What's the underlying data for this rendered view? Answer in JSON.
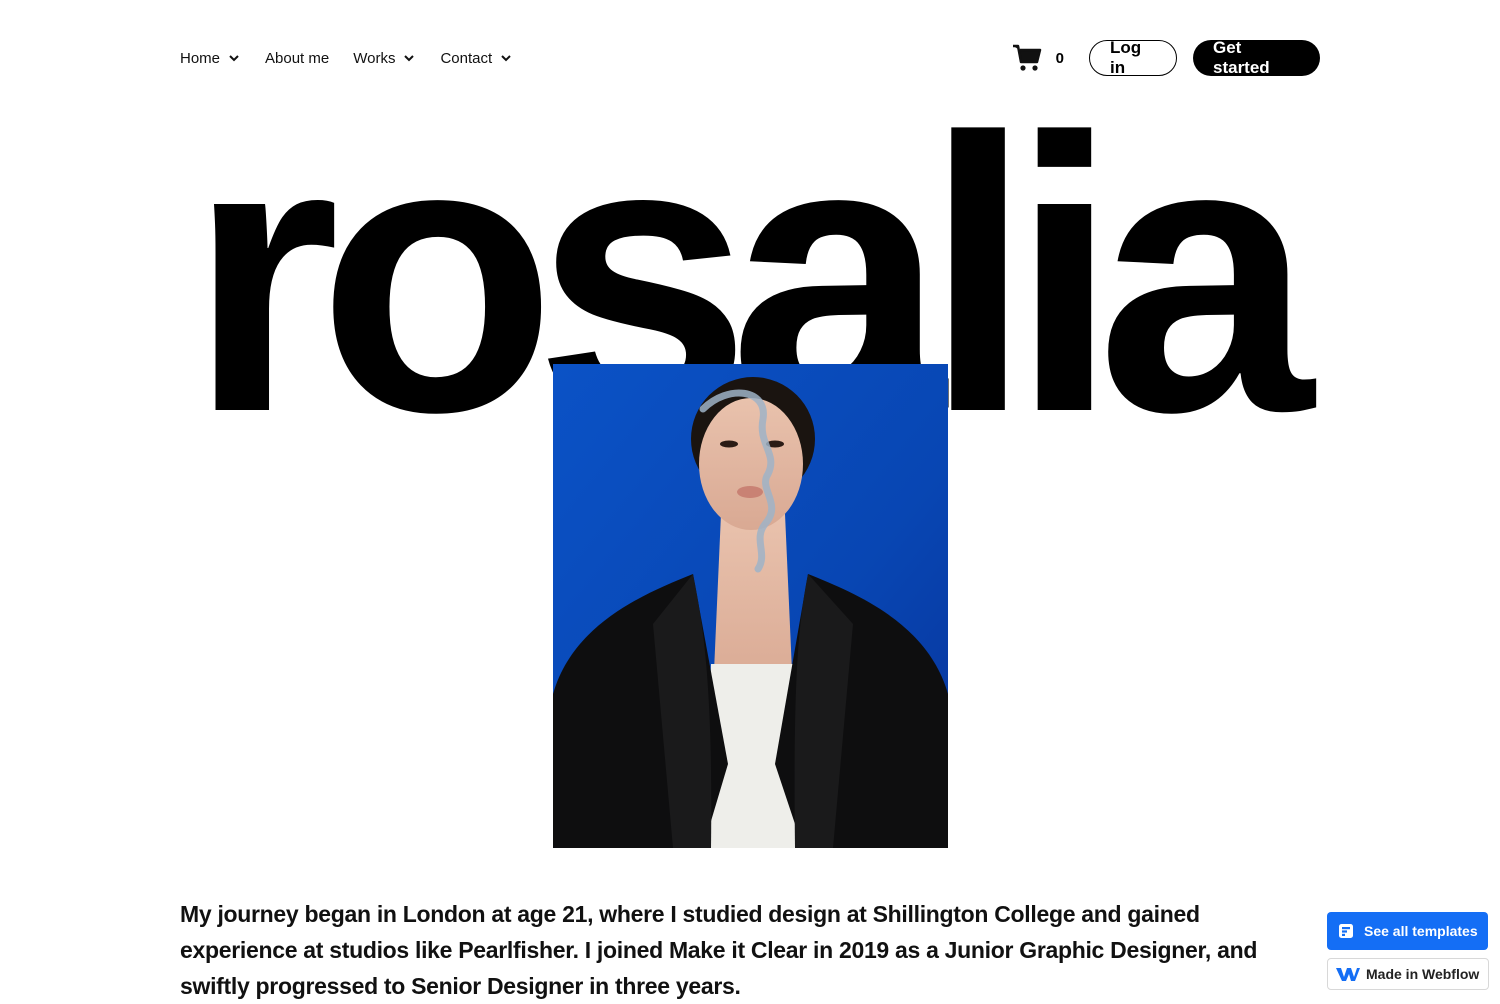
{
  "nav": {
    "items": [
      {
        "label": "Home",
        "has_dropdown": true
      },
      {
        "label": "About me",
        "has_dropdown": false
      },
      {
        "label": "Works",
        "has_dropdown": true
      },
      {
        "label": "Contact",
        "has_dropdown": true
      }
    ],
    "cart_count": "0",
    "login_label": "Log in",
    "cta_label": "Get started"
  },
  "hero": {
    "title": "rosalia",
    "portrait_icon": "portrait-photo"
  },
  "intro": {
    "text": "My journey began in London at age 21, where I studied design at Shillington College and gained experience at studios like Pearlfisher. I joined Make it Clear in 2019 as a Junior Graphic Designer, and swiftly progressed to Senior Designer in three years."
  },
  "badges": {
    "templates_label": "See all templates",
    "made_in_label": "Made in Webflow"
  },
  "colors": {
    "accent_blue": "#146ef5",
    "portrait_bg": "#0a4fc1",
    "text": "#000000"
  }
}
